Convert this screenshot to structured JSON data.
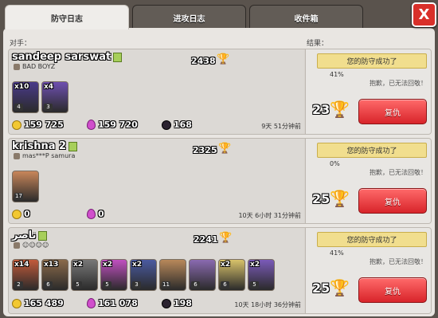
{
  "tabs": [
    "防守日志",
    "进攻日志",
    "收件箱"
  ],
  "close_label": "X",
  "headers": {
    "opponent": "对手：",
    "result": "结果："
  },
  "result_text": "您的防守成功了",
  "cant_revenge": "抱歉，已无法回敬！",
  "revenge_label": "复仇",
  "entries": [
    {
      "name": "sandeep sarswat",
      "trophies": "2438",
      "clan": "BAD BOYZ",
      "troops": [
        {
          "count": "x10",
          "level": "4",
          "color": "#4a3a8a"
        },
        {
          "count": "x4",
          "level": "3",
          "color": "#6e4fb0"
        }
      ],
      "gold": "159 725",
      "elixir": "159 720",
      "dark": "168",
      "time": "9天 51分钟前",
      "percent": "41%",
      "trophy_change": "23"
    },
    {
      "name": "krishna 2",
      "trophies": "2325",
      "clan": "mas***P samura",
      "troops": [
        {
          "count": "",
          "level": "17",
          "color": "#c9865a"
        }
      ],
      "gold": "0",
      "elixir": "0",
      "dark": "",
      "time": "10天 6小时 31分钟前",
      "percent": "0%",
      "trophy_change": "25"
    },
    {
      "name": "ناصر",
      "trophies": "2241",
      "clan": "☺☺☺☺",
      "troops": [
        {
          "count": "x14",
          "level": "2",
          "color": "#c25a3a"
        },
        {
          "count": "x13",
          "level": "6",
          "color": "#8a6a4a"
        },
        {
          "count": "x2",
          "level": "5",
          "color": "#777"
        },
        {
          "count": "x2",
          "level": "5",
          "color": "#c050c0"
        },
        {
          "count": "x2",
          "level": "3",
          "color": "#4a5aa0"
        },
        {
          "count": "",
          "level": "11",
          "color": "#b8885a"
        },
        {
          "count": "",
          "level": "6",
          "color": "#8a6ab0"
        },
        {
          "count": "x2",
          "level": "6",
          "color": "#d8c26a"
        },
        {
          "count": "x2",
          "level": "5",
          "color": "#7a5ab8"
        }
      ],
      "gold": "165 489",
      "elixir": "161 078",
      "dark": "198",
      "time": "10天 18小时 36分钟前",
      "percent": "41%",
      "trophy_change": "25"
    }
  ]
}
